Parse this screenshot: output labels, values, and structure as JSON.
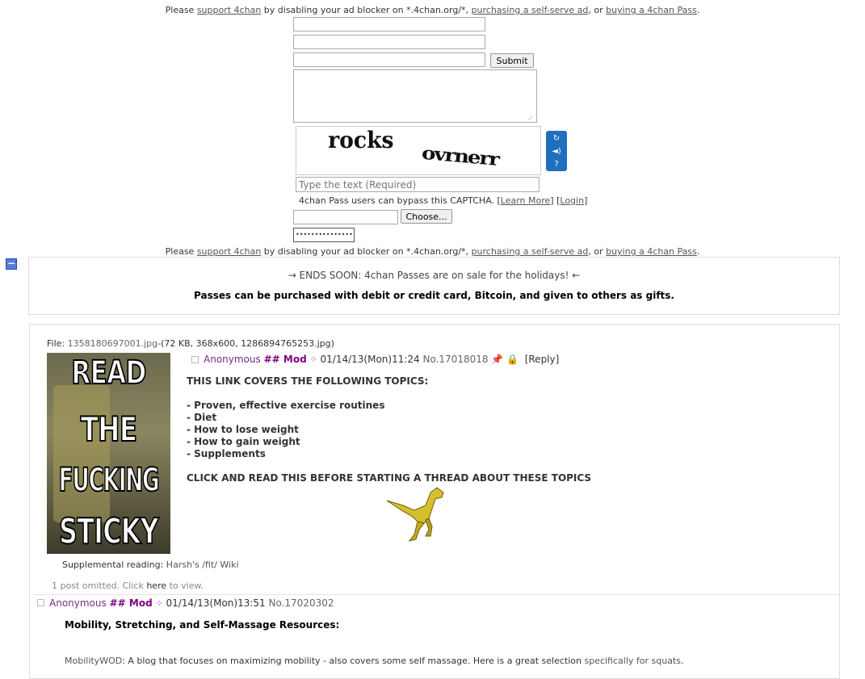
{
  "notice": {
    "pre": "Please ",
    "link1": "support 4chan",
    "mid1": " by disabling your ad blocker on *.4chan.org/*, ",
    "link2": "purchasing a self-serve ad",
    "mid2": ", or ",
    "link3": "buying a 4chan Pass",
    "post": "."
  },
  "form": {
    "submit_label": "Submit",
    "captcha_placeholder": "Type the text (Required)",
    "captcha_words": [
      "rocks",
      "ovrnerr"
    ],
    "pass_note": "4chan Pass users can bypass this CAPTCHA.",
    "learn_more": "Learn More",
    "login": "Login",
    "choose_label": "Choose...",
    "password_mask": "••••••••••••••••"
  },
  "collapse_label": "−",
  "announcement": {
    "line1": "→ ENDS SOON: 4chan Passes are on sale for the holidays! ←",
    "line2": "Passes can be purchased with debit or credit card, Bitcoin, and given to others as gifts."
  },
  "op": {
    "file_label": "File: ",
    "file_name": "1358180697001.jpg",
    "file_info": "-(72 KB, 368x600, 1286894765253.jpg)",
    "thumb_words": [
      "READ",
      "THE",
      "FUCKING",
      "STICKY"
    ],
    "name": "Anonymous",
    "capcode": "## Mod",
    "datetime": "01/14/13(Mon)11:24",
    "no_label": "No.",
    "no": "17018018",
    "reply": "[Reply]",
    "lines": [
      "THIS LINK COVERS THE FOLLOWING TOPICS:",
      "- Proven, effective exercise routines",
      "- Diet",
      "- How to lose weight",
      "- How to gain weight",
      "- Supplements",
      "CLICK AND READ THIS BEFORE STARTING A THREAD ABOUT THESE TOPICS"
    ],
    "supp_label": "Supplemental reading: ",
    "supp_link": "Harsh's /fit/ Wiki",
    "omitted_pre": "1 post omitted. Click ",
    "omitted_link": "here",
    "omitted_post": " to view."
  },
  "reply": {
    "name": "Anonymous",
    "capcode": "## Mod",
    "datetime": "01/14/13(Mon)13:51",
    "no_label": "No.",
    "no": "17020302",
    "heading": "Mobility, Stretching, and Self-Massage Resources:",
    "line_link": "MobilityWOD",
    "line_text": ": A blog that focuses on maximizing mobility - also covers some self massage. Here is a great selection ",
    "line_link2": "specifically for squats",
    "line_end": "."
  }
}
